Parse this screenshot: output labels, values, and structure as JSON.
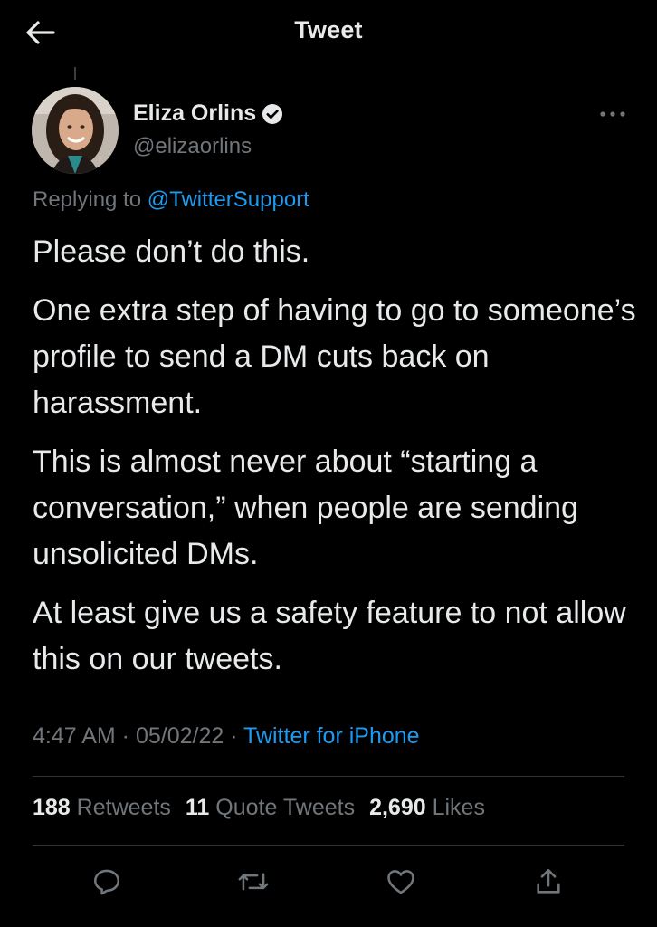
{
  "header": {
    "title": "Tweet",
    "back_icon": "arrow-left-icon"
  },
  "tweet": {
    "author": {
      "name": "Eliza Orlins",
      "handle": "@elizaorlins",
      "verified_icon": "verified-badge-icon"
    },
    "replying_to_label": "Replying to ",
    "replying_to_handle": "@TwitterSupport",
    "paragraphs": [
      "Please don’t do this.",
      "One extra step of having to go to someone’s profile to send a DM cuts back on harassment.",
      "This is almost never about “starting a conversation,” when people are sending unsolicited DMs.",
      "At least give us a safety feature to not allow this on our tweets."
    ],
    "time": "4:47 AM",
    "separator": " · ",
    "date": "05/02/22",
    "source": "Twitter for iPhone",
    "stats": {
      "retweets_count": "188",
      "retweets_label": "Retweets",
      "quotes_count": "11",
      "quotes_label": "Quote Tweets",
      "likes_count": "2,690",
      "likes_label": "Likes"
    }
  },
  "actions": {
    "reply_icon": "reply-icon",
    "retweet_icon": "retweet-icon",
    "like_icon": "heart-icon",
    "share_icon": "share-icon"
  },
  "colors": {
    "background": "#000000",
    "text": "#e7e9ea",
    "muted": "#71767b",
    "accent": "#1d9bf0",
    "divider": "#2f3336"
  }
}
